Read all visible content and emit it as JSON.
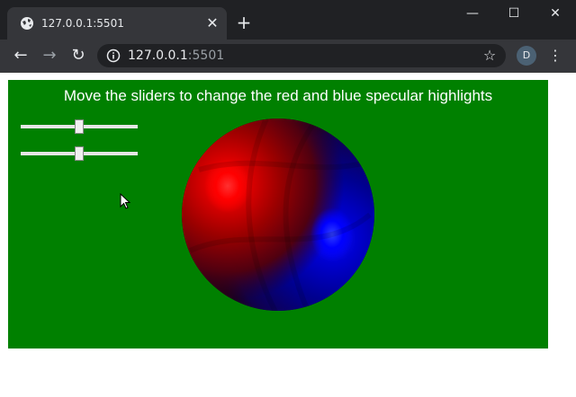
{
  "browser": {
    "tab_title": "127.0.0.1:5501",
    "url_host": "127.0.0.1",
    "url_port": ":5501",
    "profile_initial": "D"
  },
  "page": {
    "caption": "Move the sliders to change the red and blue specular highlights",
    "sliders": [
      {
        "name": "red-specular",
        "value": 0.5
      },
      {
        "name": "blue-specular",
        "value": 0.5
      }
    ],
    "colors": {
      "background": "#008000",
      "red_highlight": "#ff0000",
      "blue_highlight": "#0000ff"
    }
  }
}
